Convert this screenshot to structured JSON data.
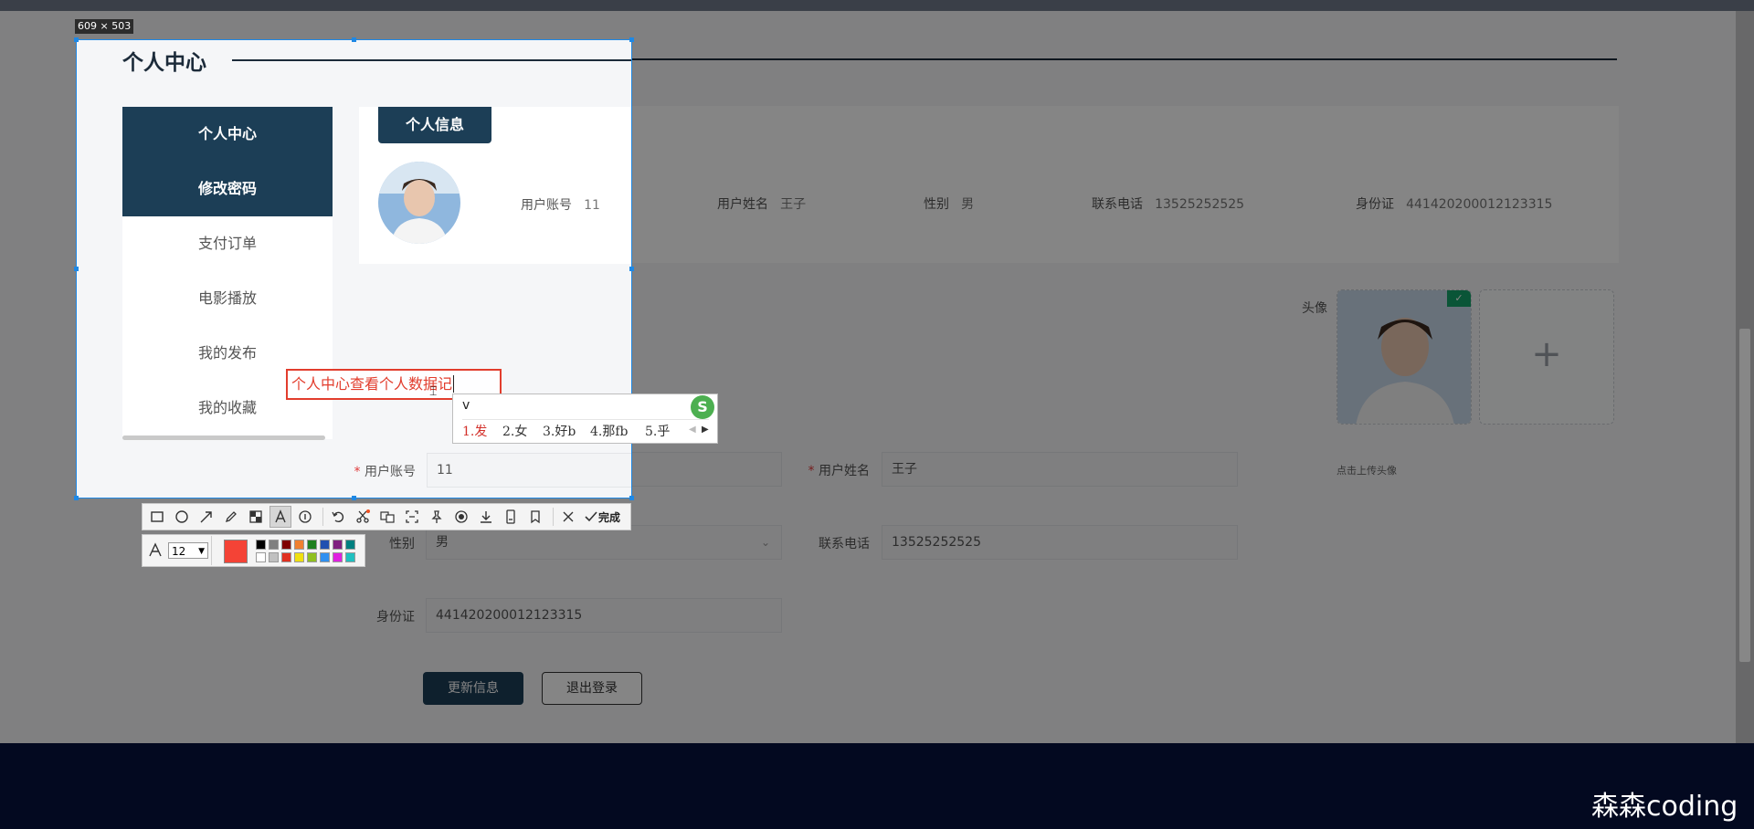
{
  "selection_size_label": "609 × 503",
  "page": {
    "title": "个人中心",
    "sidebar": {
      "items": [
        {
          "label": "个人中心",
          "active": true
        },
        {
          "label": "修改密码",
          "active": true
        },
        {
          "label": "支付订单",
          "active": false
        },
        {
          "label": "电影播放",
          "active": false
        },
        {
          "label": "我的发布",
          "active": false
        },
        {
          "label": "我的收藏",
          "active": false
        }
      ]
    },
    "info_tab_label": "个人信息",
    "info": [
      {
        "label": "用户账号",
        "value": "11"
      },
      {
        "label": "用户姓名",
        "value": "王子"
      },
      {
        "label": "性别",
        "value": "男"
      },
      {
        "label": "联系电话",
        "value": "13525252525"
      },
      {
        "label": "身份证",
        "value": "441420200012123315"
      }
    ],
    "avatar_label": "头像",
    "upload_hint": "点击上传头像",
    "upload_plus": "+",
    "form": {
      "account_label": "用户账号",
      "account_value": "11",
      "name_label": "用户姓名",
      "name_value": "王子",
      "gender_label": "性别",
      "gender_value": "男",
      "phone_label": "联系电话",
      "phone_value": "13525252525",
      "id_label": "身份证",
      "id_value": "441420200012123315",
      "required_mark": "*"
    },
    "buttons": {
      "update": "更新信息",
      "logout": "退出登录"
    }
  },
  "annotation": {
    "text": "个人中心查看个人数据记",
    "font_size": "12",
    "current_color": "#f44336",
    "palette_top": [
      "#000000",
      "#808080",
      "#800000",
      "#f08030",
      "#208020",
      "#2050b0",
      "#802080",
      "#008080"
    ],
    "palette_bottom": [
      "#ffffff",
      "#c0c0c0",
      "#e03020",
      "#f0e010",
      "#90c020",
      "#3090f0",
      "#e020e0",
      "#20c0c0"
    ],
    "done_label": "完成"
  },
  "ime": {
    "input": "v",
    "candidates": [
      "1.发",
      "2.女",
      "3.好b",
      "4.那fb",
      "5.乎"
    ]
  },
  "watermark": "森森coding"
}
